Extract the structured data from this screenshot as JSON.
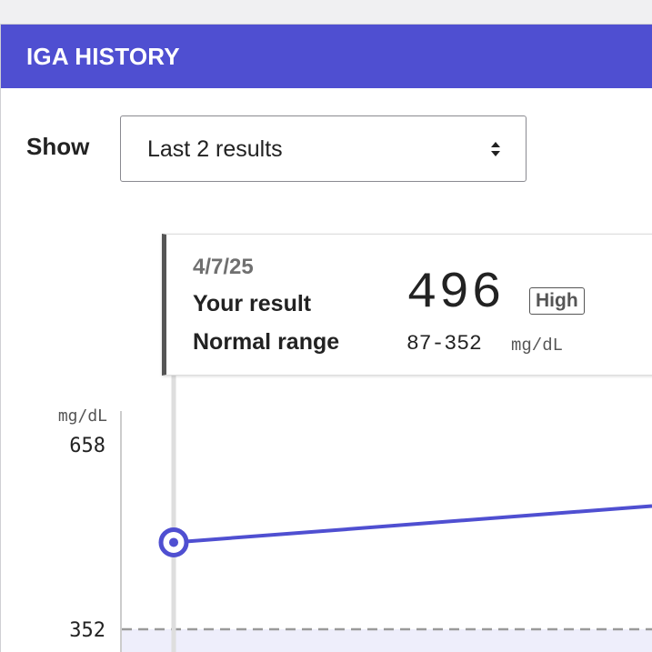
{
  "header": {
    "title": "IGA HISTORY",
    "color": "#4f4fd1"
  },
  "filter": {
    "label": "Show",
    "selected": "Last 2 results"
  },
  "tooltip": {
    "date": "4/7/25",
    "your_result_label": "Your result",
    "normal_range_label": "Normal range",
    "value": "496",
    "flag": "High",
    "range": "87-352",
    "unit": "mg/dL"
  },
  "chart_data": {
    "type": "line",
    "ylabel": "mg/dL",
    "ylim": [
      352,
      658
    ],
    "y_ticks": [
      "658",
      "352"
    ],
    "reference_line": 352,
    "series": [
      {
        "points": [
          {
            "x": "4/7/25",
            "y": 496
          }
        ]
      }
    ],
    "series_color": "#4f4fd1"
  }
}
